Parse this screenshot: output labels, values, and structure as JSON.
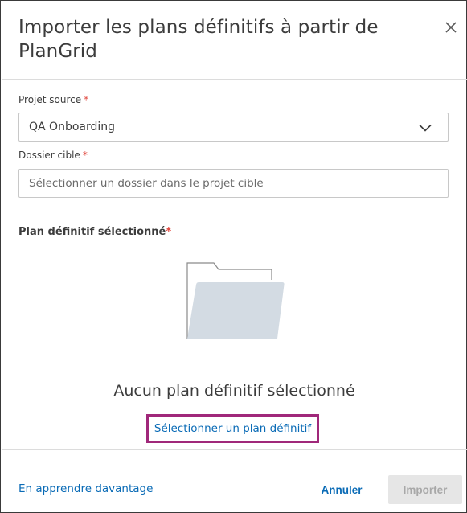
{
  "dialog": {
    "title": "Importer les plans définitifs à partir de PlanGrid",
    "close_icon": "close-icon"
  },
  "form": {
    "source_project": {
      "label": "Projet source",
      "required_mark": "*",
      "value": "QA Onboarding",
      "icon": "chevron-down-icon"
    },
    "target_folder": {
      "label": "Dossier cible",
      "required_mark": "*",
      "placeholder": "Sélectionner un dossier dans le projet cible"
    }
  },
  "selection": {
    "label": "Plan définitif sélectionné",
    "required_mark": "*",
    "empty_icon": "folder-icon",
    "empty_text": "Aucun plan définitif sélectionné",
    "select_link": "Sélectionner un plan définitif"
  },
  "footer": {
    "learn_more": "En apprendre davantage",
    "cancel": "Annuler",
    "import": "Importer"
  },
  "colors": {
    "accent_link": "#0a6bb6",
    "required": "#e0473e",
    "highlight_box": "#a0287a",
    "folder_fill": "#d3dbe3"
  }
}
